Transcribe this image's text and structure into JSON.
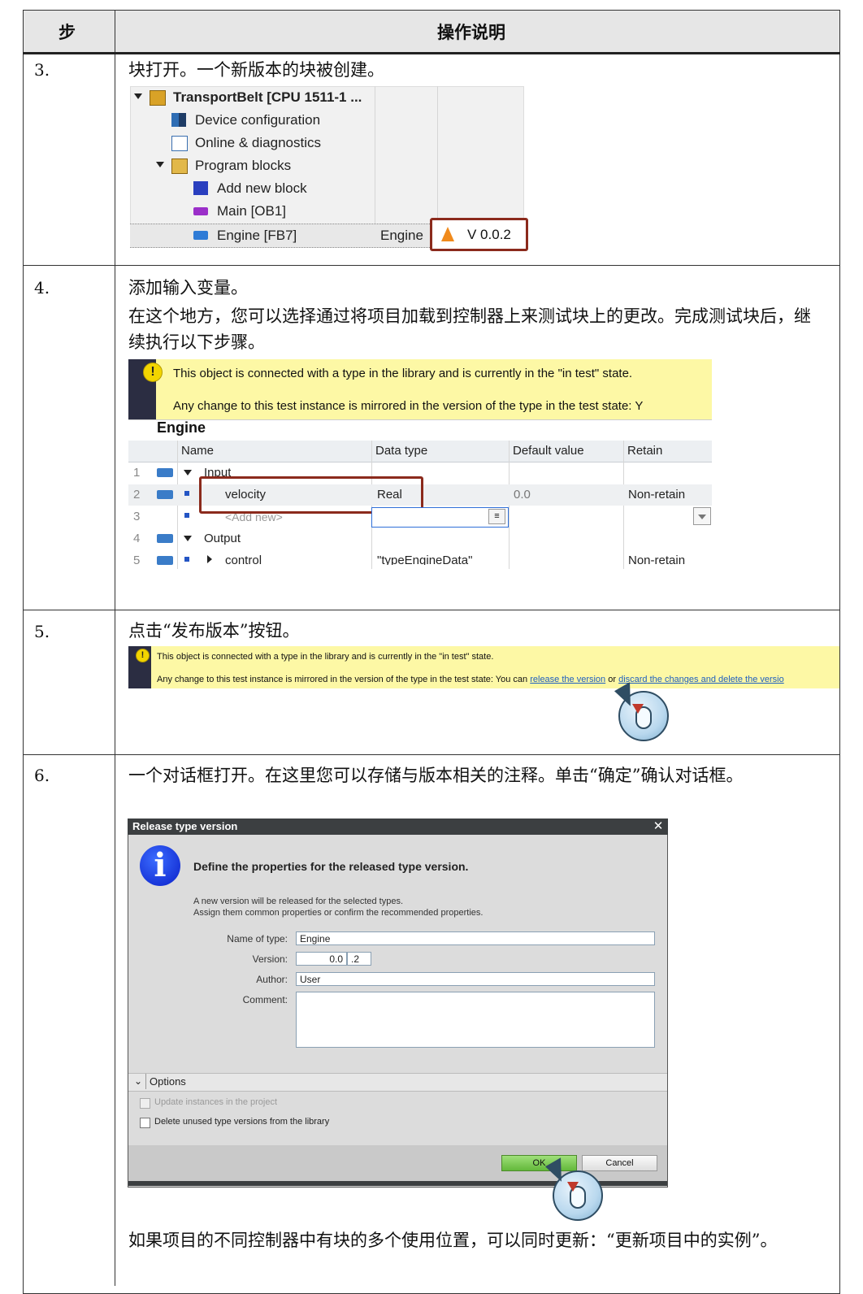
{
  "header": {
    "step_col": "步",
    "desc_col": "操作说明"
  },
  "steps": [
    {
      "number": "3.",
      "text": "块打开。一个新版本的块被创建。"
    },
    {
      "number": "4.",
      "text1": "添加输入变量。",
      "text2": "在这个地方，您可以选择通过将项目加载到控制器上来测试块上的更改。完成测试块后，继续执行以下步骤。"
    },
    {
      "number": "5.",
      "text": "点击“发布版本”按钮。"
    },
    {
      "number": "6.",
      "text1": "一个对话框打开。在这里您可以存储与版本相关的注释。单击“确定”确认对话框。",
      "text2": "如果项目的不同控制器中有块的多个使用位置，可以同时更新：“更新项目中的实例”。"
    }
  ],
  "tree": {
    "root": "TransportBelt [CPU 1511-1 ...",
    "device_config": "Device configuration",
    "online_diag": "Online & diagnostics",
    "program_blocks": "Program blocks",
    "add_block": "Add new block",
    "main": "Main [OB1]",
    "engine": "Engine [FB7]",
    "engine_type": "Engine",
    "version": "V 0.0.2"
  },
  "info_bar": {
    "line1": "This object is connected with a type in the library and is currently in the \"in test\" state.",
    "line2_trunc": "Any change to this test instance is mirrored in the version of the type in the test state: Y",
    "line2_prefix": "Any change to this test instance is mirrored in the version of the type in the test state: You can ",
    "release_link": "release the version",
    "or_text": " or ",
    "discard_link": "discard the changes and delete the versio"
  },
  "var_table": {
    "block_name": "Engine",
    "columns": [
      "Name",
      "Data type",
      "Default value",
      "Retain"
    ],
    "rows": [
      {
        "num": "1",
        "name": "Input",
        "type": "",
        "default": "",
        "retain": ""
      },
      {
        "num": "2",
        "name": "velocity",
        "type": "Real",
        "default": "0.0",
        "retain": "Non-retain"
      },
      {
        "num": "3",
        "name": "<Add new>",
        "type": "",
        "default": "",
        "retain": ""
      },
      {
        "num": "4",
        "name": "Output",
        "type": "",
        "default": "",
        "retain": ""
      },
      {
        "num": "5",
        "name": "control",
        "type": "\"typeEngineData\"",
        "default": "",
        "retain": "Non-retain"
      }
    ]
  },
  "dialog": {
    "title": "Release type version",
    "heading": "Define the properties for the released type version.",
    "sub1": "A new version will be released for the selected types.",
    "sub2": "Assign them common properties or confirm the recommended properties.",
    "name_label": "Name of type:",
    "name_value": "Engine",
    "version_label": "Version:",
    "version_major": "0.0",
    "version_minor": ".2",
    "author_label": "Author:",
    "author_value": "User",
    "comment_label": "Comment:",
    "options_label": "Options",
    "opt_update": "Update instances in the project",
    "opt_delete": "Delete unused type versions from the library",
    "ok": "OK",
    "cancel": "Cancel",
    "close": "✕"
  }
}
